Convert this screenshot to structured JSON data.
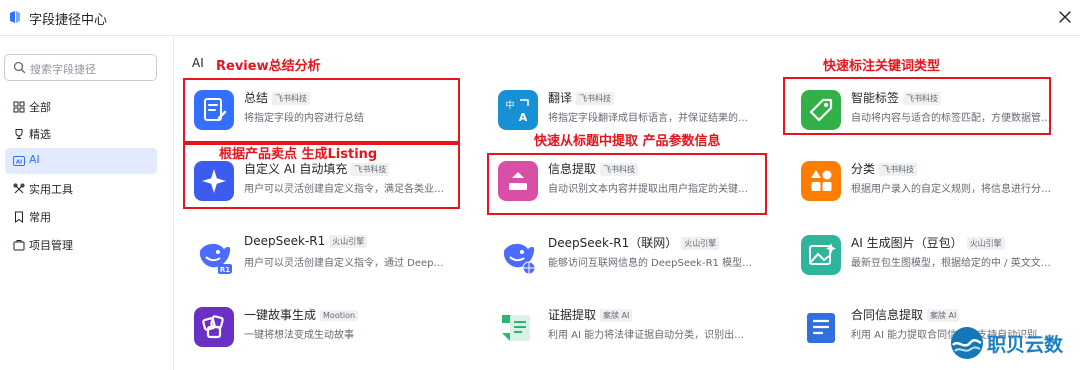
{
  "window": {
    "title": "字段捷径中心"
  },
  "sidebar": {
    "search_placeholder": "搜索字段捷径",
    "items": [
      {
        "label": "全部",
        "icon": "grid-icon"
      },
      {
        "label": "精选",
        "icon": "trophy-icon"
      },
      {
        "label": "AI",
        "icon": "ai-icon",
        "active": true
      },
      {
        "label": "实用工具",
        "icon": "tools-icon"
      },
      {
        "label": "常用",
        "icon": "bookmark-icon"
      },
      {
        "label": "项目管理",
        "icon": "briefcase-icon"
      }
    ]
  },
  "main": {
    "section_title": "AI",
    "cards": [
      {
        "name": "总结",
        "tag": "飞书科技",
        "desc": "将指定字段的内容进行总结",
        "icon": "summary-icon",
        "color": "#3370ff"
      },
      {
        "name": "翻译",
        "tag": "飞书科技",
        "desc": "将指定字段翻译成目标语言，并保证结果的…",
        "icon": "translate-icon",
        "color": "#1890d6"
      },
      {
        "name": "智能标签",
        "tag": "飞书科技",
        "desc": "自动将内容与适合的标签匹配，方便数据管…",
        "icon": "tag-icon",
        "color": "#34b048"
      },
      {
        "name": "自定义 AI 自动填充",
        "tag": "飞书科技",
        "desc": "用户可以灵活创建自定义指令，满足各类业…",
        "icon": "sparkle-icon",
        "color": "#3c5cf0"
      },
      {
        "name": "信息提取",
        "tag": "飞书科技",
        "desc": "自动识别文本内容并提取出用户指定的关键…",
        "icon": "extract-icon",
        "color": "#d94fa8"
      },
      {
        "name": "分类",
        "tag": "飞书科技",
        "desc": "根据用户录入的自定义规则，将信息进行分…",
        "icon": "category-icon",
        "color": "#ff7d00"
      },
      {
        "name": "DeepSeek-R1",
        "tag": "火山引擎",
        "desc": "用户可以灵活创建自定义指令，通过 DeepSe…",
        "icon": "deepseek-icon",
        "color": "#4d6bfe"
      },
      {
        "name": "DeepSeek-R1（联网）",
        "tag": "火山引擎",
        "desc": "能够访问互联网信息的 DeepSeek-R1 模型，…",
        "icon": "deepseek-web-icon",
        "color": "#4d6bfe"
      },
      {
        "name": "AI 生成图片（豆包）",
        "tag": "火山引擎",
        "desc": "最新豆包生图模型，根据给定的中 / 英文文字…",
        "icon": "image-gen-icon",
        "color": "#2fb59b"
      },
      {
        "name": "一键故事生成",
        "tag": "Mootion",
        "desc": "一键将想法变成生动故事",
        "icon": "story-icon",
        "color": "#6a2fc4"
      },
      {
        "name": "证据提取",
        "tag": "案牍 AI",
        "desc": "利用 AI 能力将法律证据自动分类，识别出关…",
        "icon": "evidence-icon",
        "color": "#2bb673"
      },
      {
        "name": "合同信息提取",
        "tag": "案牍 AI",
        "desc": "利用 AI 能力提取合同信息，支持自动识别关…",
        "icon": "contract-icon",
        "color": "#2f6fe0"
      }
    ]
  },
  "annotations": [
    {
      "label": "Review总结分析"
    },
    {
      "label": "根据产品卖点 生成Listing"
    },
    {
      "label": "快速从标题中提取 产品参数信息"
    },
    {
      "label": "快速标注关键词类型"
    }
  ],
  "watermark": {
    "text": "职贝云数",
    "icon": "wave-logo-icon"
  }
}
